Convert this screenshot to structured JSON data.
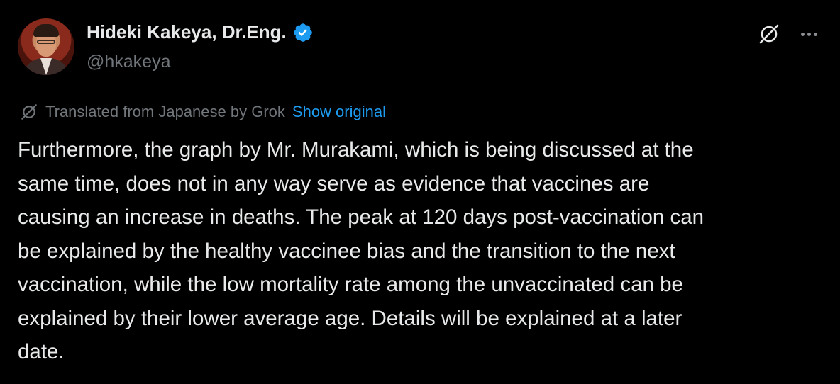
{
  "author": {
    "display_name": "Hideki Kakeya, Dr.Eng.",
    "handle": "@hkakeya",
    "verified": true,
    "verified_color": "#1d9bf0"
  },
  "actions": {
    "grok_icon": "grok-icon",
    "more_icon": "more-icon"
  },
  "translation": {
    "label": "Translated from Japanese by Grok",
    "show_original_label": "Show original",
    "link_color": "#1d9bf0"
  },
  "tweet": {
    "lines": [
      "Furthermore, the graph by Mr. Murakami, which is being discussed at the",
      "same time, does not in any way serve as evidence that vaccines are",
      "causing an increase in deaths. The peak at 120 days post-vaccination can",
      "be explained by the healthy vaccinee bias and the transition to the next",
      "vaccination, while the low mortality rate among the unvaccinated can be",
      "explained by their lower average age. Details will be explained at a later",
      "date."
    ]
  }
}
